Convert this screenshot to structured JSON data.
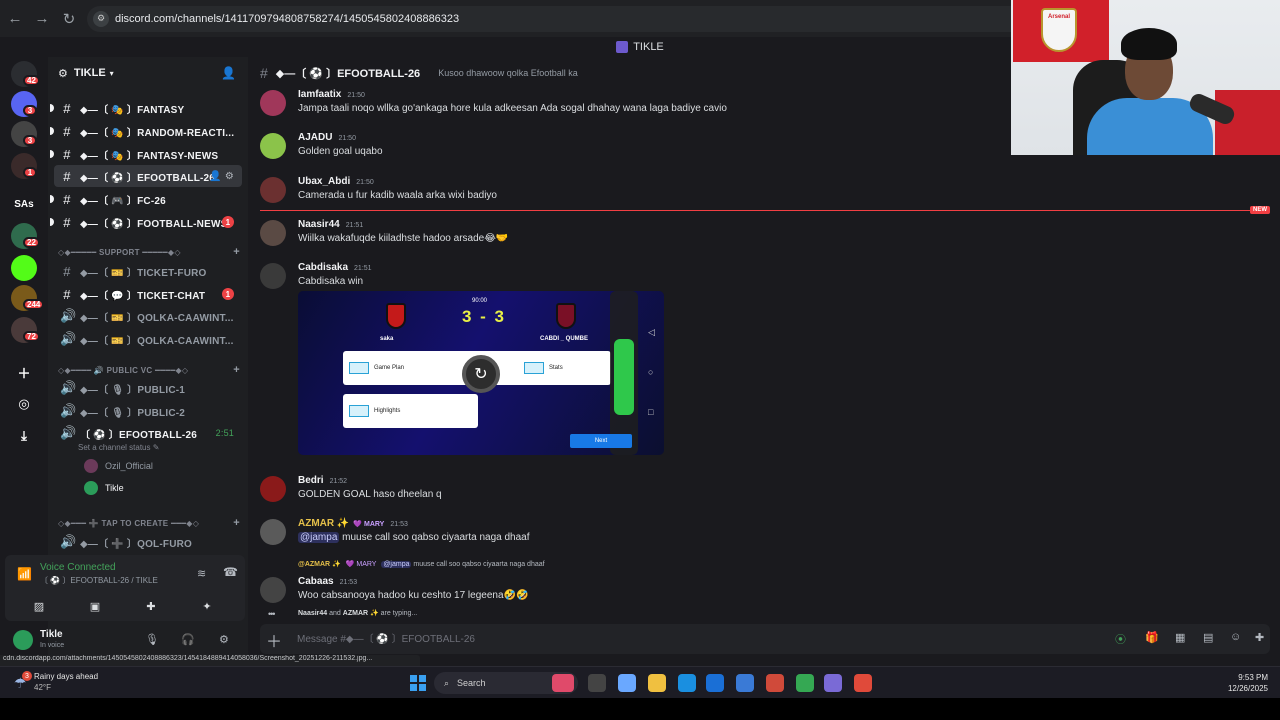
{
  "browser": {
    "url": "discord.com/channels/1411709794808758274/1450545802408886323"
  },
  "window_title": "TIKLE",
  "server_rail": [
    {
      "label": "",
      "badge": "42",
      "color": "#2b2d31"
    },
    {
      "label": "",
      "badge": "3",
      "color": "#5865f2"
    },
    {
      "label": "",
      "badge": "3",
      "color": "#444"
    },
    {
      "label": "",
      "badge": "1",
      "color": "#3a2a2a"
    },
    {
      "label": "SAs",
      "badge": "",
      "color": "#1a1a1e"
    },
    {
      "label": "",
      "badge": "22",
      "color": "#2f6b4d"
    },
    {
      "label": "",
      "badge": "",
      "color": "#53fc18"
    },
    {
      "label": "",
      "badge": "244",
      "color": "#7a5a1a"
    },
    {
      "label": "",
      "badge": "72",
      "color": "#4a3a3a"
    }
  ],
  "guild": {
    "name": "TIKLE"
  },
  "channels": [
    {
      "name": "◆—〔 🎭 〕FANTASY",
      "icon": "#",
      "badge": ""
    },
    {
      "name": "◆—〔 🎭 〕RANDOM-REACTI...",
      "icon": "#",
      "badge": ""
    },
    {
      "name": "◆—〔 🎭 〕FANTASY-NEWS",
      "icon": "#",
      "badge": ""
    },
    {
      "name": "◆—〔 ⚽ 〕EFOOTBALL-26",
      "icon": "#",
      "badge": ""
    },
    {
      "name": "◆—〔 🎮 〕FC-26",
      "icon": "#",
      "badge": ""
    },
    {
      "name": "◆—〔 ⚽ 〕FOOTBALL-NEWS",
      "icon": "#",
      "badge": "1"
    }
  ],
  "support_category": "◇◆━━━━━ SUPPORT ━━━━━◆◇",
  "support_channels": [
    {
      "name": "◆—〔 🎫 〕TICKET-FURO",
      "icon": "#",
      "badge": ""
    },
    {
      "name": "◆—〔 💬 〕TICKET-CHAT",
      "icon": "#",
      "badge": "1"
    },
    {
      "name": "◆—〔 🎫 〕QOLKA-CAAWINT...",
      "icon": "🔊",
      "badge": ""
    },
    {
      "name": "◆—〔 🎫 〕QOLKA-CAAWINT...",
      "icon": "🔊",
      "badge": ""
    }
  ],
  "vc_category": "◇◆━━━━ 🔊 PUBLIC VC ━━━━◆◇",
  "vc_channels": [
    {
      "name": "◆—〔 🎙 〕PUBLIC-1",
      "icon": "🔊"
    },
    {
      "name": "◆—〔 🎙 〕PUBLIC-2",
      "icon": "🔊"
    }
  ],
  "active_vc": {
    "name": "〔 ⚽ 〕EFOOTBALL-26",
    "time": "2:51",
    "status_prompt": "Set a channel status ✎",
    "users": [
      {
        "name": "Ozil_Official",
        "color": "#6b3a5a"
      },
      {
        "name": "Tikle",
        "color": "#2b9c5a"
      }
    ]
  },
  "create_category": "◇◆━━━ ➕ TAP TO CREATE ━━━◆◇",
  "create_channels": [
    {
      "name": "◆—〔 ➕ 〕QOL-FURO",
      "icon": "🔊"
    }
  ],
  "voice_panel": {
    "status": "Voice Connected",
    "location": "〔 ⚽ 〕EFOOTBALL-26 / TIKLE"
  },
  "user_panel": {
    "name": "Tikle",
    "status": "In voice"
  },
  "channel_header": {
    "name": "◆—〔 ⚽ 〕EFOOTBALL-26",
    "topic": "Kusoo dhawoow qolka Efootball ka"
  },
  "messages": [
    {
      "author": "Iamfaatix",
      "time": "21:50",
      "text": "Jampa taali noqo wllka go'ankaga hore kula adkeesan Ada sogal dhahay wana laga badiye cavio",
      "avatar": "#a0375a"
    },
    {
      "author": "AJADU",
      "time": "21:50",
      "text": "Golden goal uqabo",
      "avatar": "#8bc34a"
    },
    {
      "author": "Ubax_Abdi",
      "time": "21:50",
      "text": "Camerada u fur kadib waala arka wixi badiyo",
      "avatar": "#6b3030"
    },
    {
      "author": "Naasir44",
      "time": "21:51",
      "text": "Wiilka wakafuqde kiiladhste  hadoo arsade😂🤝",
      "avatar": "#5a4a44"
    },
    {
      "author": "Cabdisaka",
      "time": "21:51",
      "text": "Cabdisaka win",
      "avatar": "#3a3a3a"
    },
    {
      "author": "Bedri",
      "time": "21:52",
      "text": "GOLDEN GOAL haso dheelan q",
      "avatar": "#8a1a1a"
    },
    {
      "author": "AZMAR ✨",
      "time": "21:53",
      "role": "💜 MARY",
      "mention": "@jampa",
      "text": " muuse call soo qabso ciyaarta naga dhaaf",
      "avatar": "#5a5a5a"
    },
    {
      "author": "Cabaas",
      "time": "21:53",
      "text": "Woo cabsanooya hadoo ku ceshto 17 legeena🤣🤣",
      "avatar": "#444"
    }
  ],
  "reply_preview": {
    "author": "@AZMAR ✨",
    "role": "💜 MARY",
    "mention": "@jampa",
    "text": " muuse call soo qabso ciyaarta naga dhaaf"
  },
  "new_label": "NEW",
  "attachment": {
    "clock": "90:00",
    "score": "3 - 3",
    "team1": "saka",
    "team2": "CABDI _ QUMBE",
    "menu": [
      "Game Plan",
      "Stats",
      "Highlights"
    ],
    "next_label": "Next"
  },
  "typing": {
    "user1": "Naasir44",
    "joiner": " and ",
    "user2": "AZMAR ✨",
    "suffix": " are typing..."
  },
  "composer": {
    "placeholder": "Message #◆—〔 ⚽ 〕EFOOTBALL-26"
  },
  "status_url": "cdn.discordapp.com/attachments/1450545802408886323/1454184889414058036/Screenshot_20251226-211532.jpg...",
  "taskbar": {
    "weather_badge": "3",
    "weather": "Rainy days ahead",
    "temp": "42°F",
    "search": "Search",
    "time": "9:53 PM",
    "date": "12/26/2025",
    "apps": [
      "#e04a6a",
      "#444",
      "#6aa8ff",
      "#f0c040",
      "#1a8fe0",
      "#1a6fd6",
      "#3a7ad6",
      "#d04a3a",
      "#35a853",
      "#7a6ad6",
      "#e04a3a"
    ]
  },
  "webcam": {
    "flag_text": "Arsenal"
  }
}
